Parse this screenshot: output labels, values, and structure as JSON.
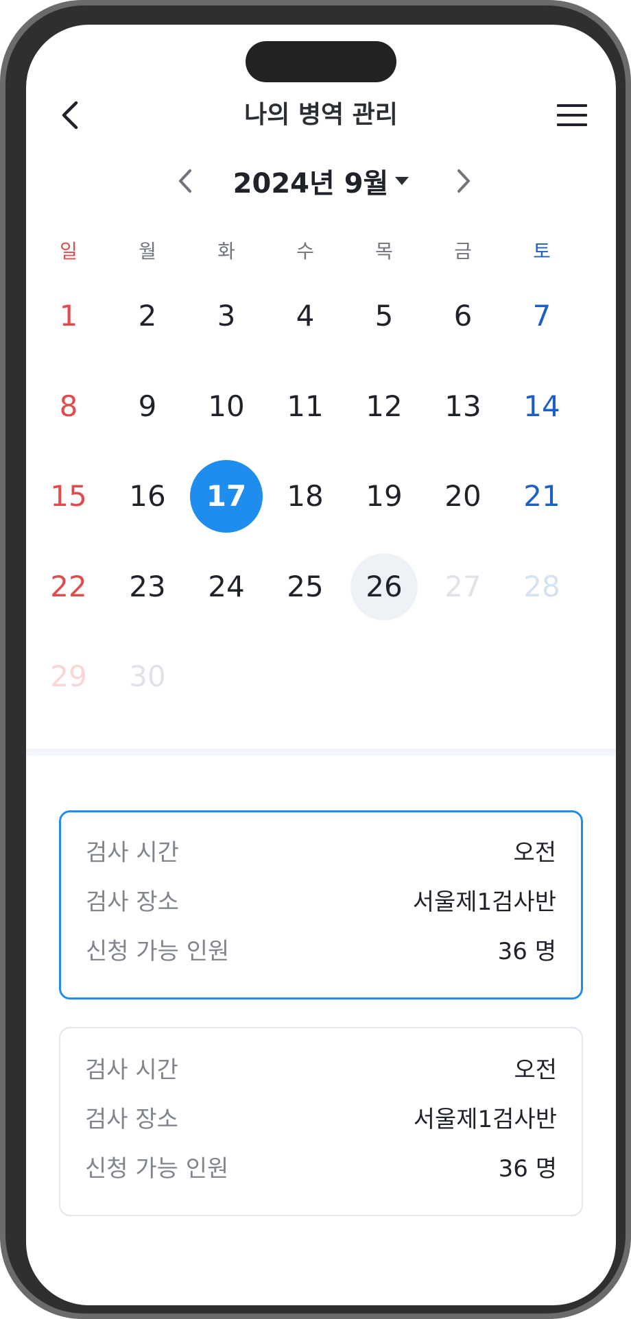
{
  "header": {
    "title": "나의 병역 관리"
  },
  "calendar": {
    "month_label": "2024년 9월",
    "weekdays": [
      "일",
      "월",
      "화",
      "수",
      "목",
      "금",
      "토"
    ],
    "weeks": [
      [
        "1",
        "2",
        "3",
        "4",
        "5",
        "6",
        "7"
      ],
      [
        "8",
        "9",
        "10",
        "11",
        "12",
        "13",
        "14"
      ],
      [
        "15",
        "16",
        "17",
        "18",
        "19",
        "20",
        "21"
      ],
      [
        "22",
        "23",
        "24",
        "25",
        "26",
        "27",
        "28"
      ],
      [
        "29",
        "30",
        "",
        "",
        "",
        "",
        ""
      ]
    ],
    "selected_day": "17",
    "today_day": "26",
    "disabled_days": [
      "27",
      "28",
      "29",
      "30"
    ]
  },
  "slots": [
    {
      "state": "selected",
      "rows": [
        {
          "label": "검사 시간",
          "value": "오전"
        },
        {
          "label": "검사 장소",
          "value": "서울제1검사반"
        },
        {
          "label": "신청 가능 인원",
          "value": "36 명"
        }
      ]
    },
    {
      "state": "unselected",
      "rows": [
        {
          "label": "검사 시간",
          "value": "오전"
        },
        {
          "label": "검사 장소",
          "value": "서울제1검사반"
        },
        {
          "label": "신청 가능 인원",
          "value": "36 명"
        }
      ]
    }
  ],
  "colors": {
    "accent": "#1e8ded",
    "sunday": "#e04b4b",
    "saturday": "#1d5fc4",
    "today_bg": "#eef1f5"
  },
  "icons": {
    "back": "chevron-left-icon",
    "menu": "hamburger-menu-icon",
    "prev_month": "chevron-left-icon",
    "next_month": "chevron-right-icon",
    "month_dropdown": "caret-down-icon"
  }
}
